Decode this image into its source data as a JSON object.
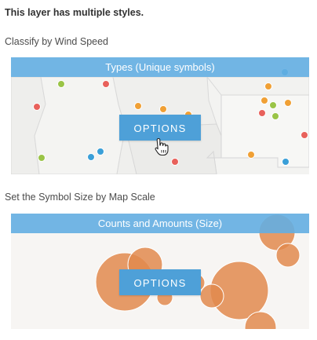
{
  "heading": "This layer has multiple styles.",
  "section1": {
    "label": "Classify by Wind Speed",
    "card_title": "Types (Unique symbols)",
    "button": "OPTIONS",
    "point_colors": [
      "#e8615b",
      "#f0a035",
      "#9ac447",
      "#3a9fd8"
    ]
  },
  "section2": {
    "label": "Set the Symbol Size by Map Scale",
    "card_title": "Counts and Amounts (Size)",
    "button": "OPTIONS",
    "bubble_color": "#e2894d"
  },
  "colors": {
    "header_bar": "#63aee2",
    "button": "#4ea0d8"
  },
  "icons": {
    "cursor": "hand-pointer-icon"
  }
}
